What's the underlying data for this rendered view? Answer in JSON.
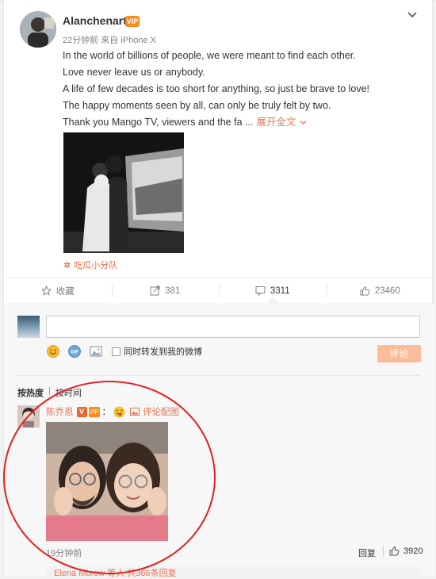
{
  "post": {
    "username": "Alanchenart",
    "vip_badge": "VIP",
    "meta": "22分钟前 来自 iPhone X",
    "lines": [
      "In the world of billions of people, we were meant to find each other.",
      "Love never leave us or anybody.",
      "A life of few decades is too short for anything, so just be brave to love!",
      "The happy moments seen by all, can only be truly felt by two.",
      "Thank you Mango TV, viewers and the fa ..."
    ],
    "expand_label": "展开全文",
    "source_label": "吃瓜小分队"
  },
  "actions": {
    "favorite": "收藏",
    "repost": "381",
    "comment": "3311",
    "like": "23460"
  },
  "composer": {
    "placeholder": "",
    "repost_label": "同时转发到我的微博",
    "submit_label": "评论"
  },
  "sort": {
    "hot": "按热度",
    "time": "按时间"
  },
  "comment": {
    "name": "陈乔恩",
    "verified": "V",
    "vip": "VIP",
    "colon": "：",
    "picture_label": "评论配图",
    "time": "19分钟前",
    "reply_label": "回复",
    "likes": "3920",
    "sub_reply": "Elena Mbrow 等人 共366条回复"
  },
  "colors": {
    "accent": "#eb7350",
    "annotation_circle": "#e02020"
  }
}
